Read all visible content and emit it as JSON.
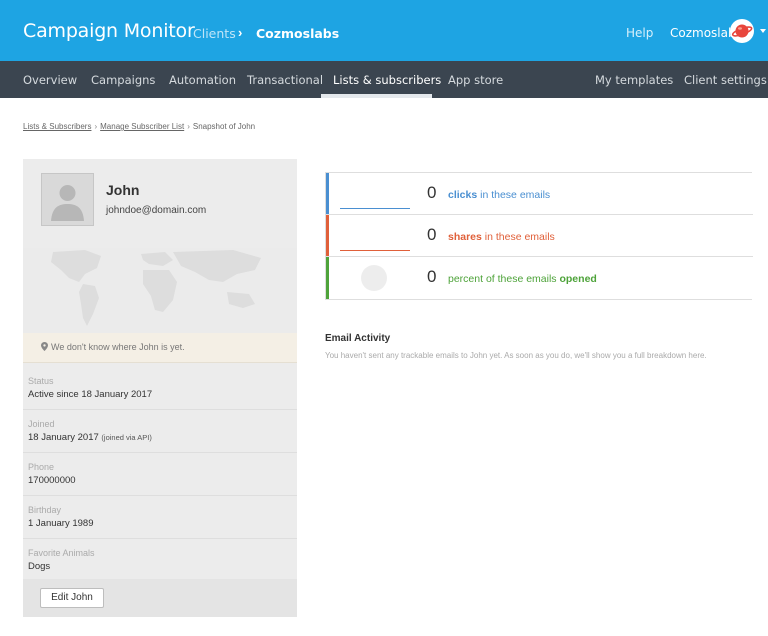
{
  "header": {
    "brand": "Campaign Monitor",
    "clients_label": "Clients",
    "separator": "›",
    "current_client": "Cozmoslabs",
    "help_label": "Help",
    "account_name": "Cozmoslabs"
  },
  "nav": {
    "items": [
      {
        "label": "Overview"
      },
      {
        "label": "Campaigns"
      },
      {
        "label": "Automation"
      },
      {
        "label": "Transactional"
      },
      {
        "label": "Lists & subscribers"
      },
      {
        "label": "App store"
      },
      {
        "label": "My templates"
      },
      {
        "label": "Client settings"
      }
    ],
    "active_item": "Lists & subscribers"
  },
  "breadcrumb": {
    "items": [
      "Lists & Subscribers",
      "Manage Subscriber List",
      "Snapshot of John"
    ],
    "separator": "›"
  },
  "subscriber": {
    "name": "John",
    "email": "johndoe@domain.com",
    "location_message": "We don't know where John is yet.",
    "fields": [
      {
        "label": "Status",
        "value": "Active since 18 January 2017",
        "note": ""
      },
      {
        "label": "Joined",
        "value": "18 January 2017",
        "note": "(joined via API)"
      },
      {
        "label": "Phone",
        "value": "170000000",
        "note": ""
      },
      {
        "label": "Birthday",
        "value": "1 January 1989",
        "note": ""
      },
      {
        "label": "Favorite Animals",
        "value": "Dogs",
        "note": ""
      }
    ],
    "edit_button": "Edit John"
  },
  "stats": [
    {
      "value": "0",
      "keyword": "clicks",
      "rest": " in these emails",
      "color": "#4a8fd1"
    },
    {
      "value": "0",
      "keyword": "shares",
      "rest": " in these emails",
      "color": "#e0603a"
    },
    {
      "value": "0",
      "prefix": "percent of these emails ",
      "keyword": "opened",
      "color": "#4ea33a"
    }
  ],
  "activity": {
    "title": "Email Activity",
    "message": "You haven't sent any trackable emails to John yet. As soon as you do, we'll show you a full breakdown here."
  },
  "colors": {
    "header_blue": "#1ea4e3",
    "nav_dark": "#3b4550",
    "clicks_blue": "#4a8fd1",
    "shares_orange": "#e0603a",
    "opened_green": "#4ea33a",
    "avatar_accent": "#e8463c"
  },
  "icons": {
    "avatar": "planet-avatar-icon",
    "location": "map-pin-icon",
    "dropdown": "caret-down-icon",
    "profile": "user-silhouette-icon",
    "map": "world-map"
  }
}
